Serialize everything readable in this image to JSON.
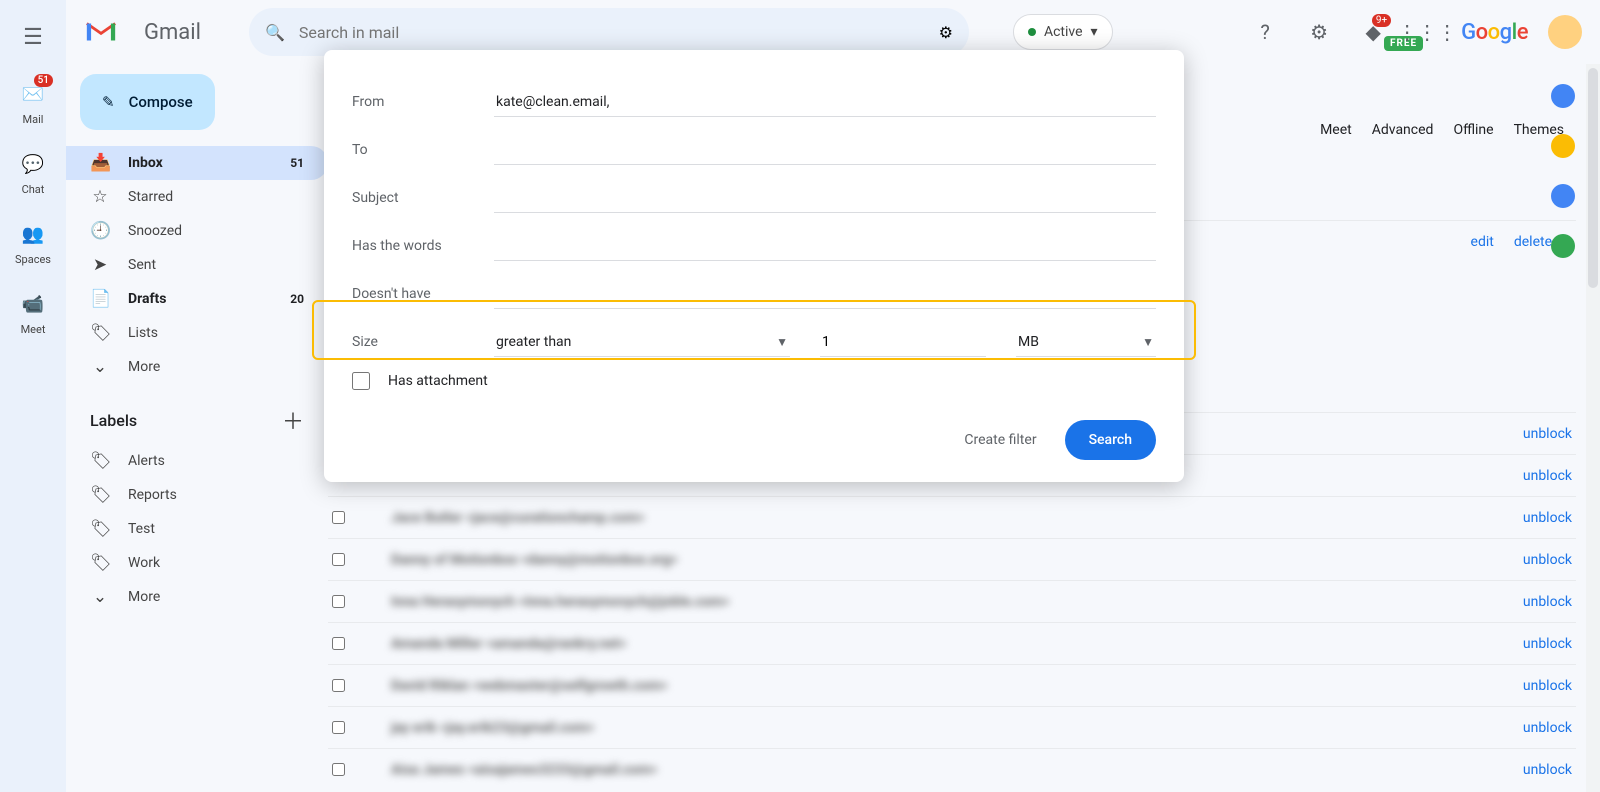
{
  "header": {
    "product": "Gmail",
    "search_placeholder": "Search in mail",
    "status": "Active",
    "notification_badge": "9+",
    "google": [
      "G",
      "o",
      "o",
      "g",
      "l",
      "e"
    ],
    "free_pill": "FREE"
  },
  "rail": {
    "items": [
      {
        "label": "Mail",
        "badge": "51"
      },
      {
        "label": "Chat",
        "badge": ""
      },
      {
        "label": "Spaces",
        "badge": ""
      },
      {
        "label": "Meet",
        "badge": ""
      }
    ]
  },
  "sidebar": {
    "compose": "Compose",
    "items": [
      {
        "label": "Inbox",
        "count": "51",
        "icon": "📥",
        "active": true,
        "bold": true
      },
      {
        "label": "Starred",
        "count": "",
        "icon": "☆",
        "active": false,
        "bold": false
      },
      {
        "label": "Snoozed",
        "count": "",
        "icon": "🕘",
        "active": false,
        "bold": false
      },
      {
        "label": "Sent",
        "count": "",
        "icon": "➤",
        "active": false,
        "bold": false
      },
      {
        "label": "Drafts",
        "count": "20",
        "icon": "📄",
        "active": false,
        "bold": true
      },
      {
        "label": "Lists",
        "count": "",
        "icon": "🏷",
        "active": false,
        "bold": false
      },
      {
        "label": "More",
        "count": "",
        "icon": "⌄",
        "active": false,
        "bold": false
      }
    ],
    "labels_header": "Labels",
    "labels": [
      {
        "label": "Alerts"
      },
      {
        "label": "Reports"
      },
      {
        "label": "Test"
      },
      {
        "label": "Work"
      },
      {
        "label": "More"
      }
    ]
  },
  "settings_tabs": [
    "Meet",
    "Advanced",
    "Offline",
    "Themes"
  ],
  "top_actions": {
    "edit": "edit",
    "delete": "delete"
  },
  "blocked": {
    "unblock": "unblock",
    "rows": [
      "Jace Butler <jace@curationchamp.com>",
      "Danny of Motionbox <danny@motionbox.org>",
      "Inna Herasymovych <inna.herasymovych@joble.com>",
      "Amanda Miller <amanda@rankry.net>",
      "David Riklan <webmaster@selfgrowth.com>",
      "jay erik <jay.erik23@gmail.com>",
      "Aisa James <aisajames3233@gmail.com>"
    ]
  },
  "modal": {
    "from_label": "From",
    "from_value": "kate@clean.email,",
    "to_label": "To",
    "subject_label": "Subject",
    "has_words_label": "Has the words",
    "doesnt_have_label": "Doesn't have",
    "size_label": "Size",
    "size_operator": "greater than",
    "size_value": "1",
    "size_unit": "MB",
    "has_attachment": "Has attachment",
    "create_filter": "Create filter",
    "search": "Search"
  }
}
